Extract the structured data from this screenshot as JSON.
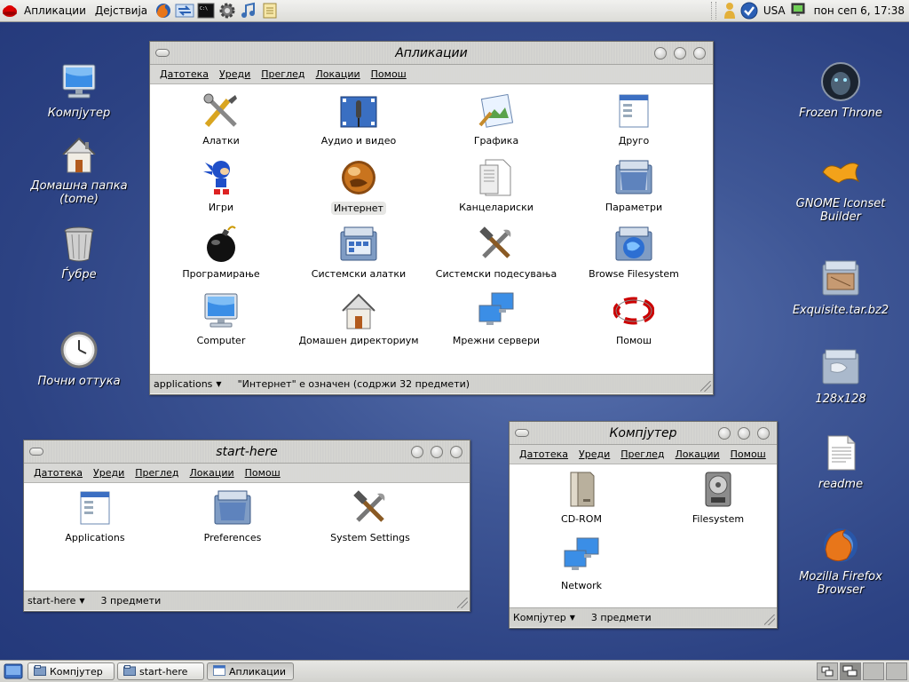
{
  "top_panel": {
    "menus": [
      "Апликации",
      "Дејствија"
    ],
    "launchers": [
      "firefox-icon",
      "network-arrows-icon",
      "terminal-icon",
      "gear-icon",
      "music-icon",
      "notes-icon"
    ],
    "keyboard_layout": "USA",
    "clock": "пон сеп  6, 17:38"
  },
  "desktop_icons": {
    "computer": "Компјутер",
    "home": "Домашна папка\n(tome)",
    "trash": "Ѓубре",
    "clock": "Почни оттука",
    "frozen_throne": "Frozen Throne",
    "gnome_iconset": "GNOME Iconset Builder",
    "exquisite": "Exquisite.tar.bz2",
    "folder128": "128x128",
    "readme": "readme",
    "firefox": "Mozilla Firefox Browser"
  },
  "menu_labels": [
    "Датотека",
    "Уреди",
    "Преглед",
    "Локации",
    "Помош"
  ],
  "win_apps": {
    "title": "Апликации",
    "items": [
      "Алатки",
      "Аудио и видео",
      "Графика",
      "Друго",
      "Игри",
      "Интернет",
      "Канцелариски",
      "Параметри",
      "Програмирање",
      "Системски алатки",
      "Системски подесувања",
      "Browse Filesystem",
      "Computer",
      "Домашен директориум",
      "Мрежни сервери",
      "Помош"
    ],
    "location": "applications",
    "status": "\"Интернет\" е означен (содржи 32 предмети)"
  },
  "win_start": {
    "title": "start-here",
    "items": [
      "Applications",
      "Preferences",
      "System Settings"
    ],
    "location": "start-here",
    "status": "3 предмети"
  },
  "win_computer": {
    "title": "Компјутер",
    "items": [
      "CD-ROM",
      "Filesystem",
      "Network"
    ],
    "location": "Компјутер",
    "status": "3 предмети"
  },
  "taskbar": {
    "buttons": [
      "Компјутер",
      "start-here",
      "Апликации"
    ]
  }
}
